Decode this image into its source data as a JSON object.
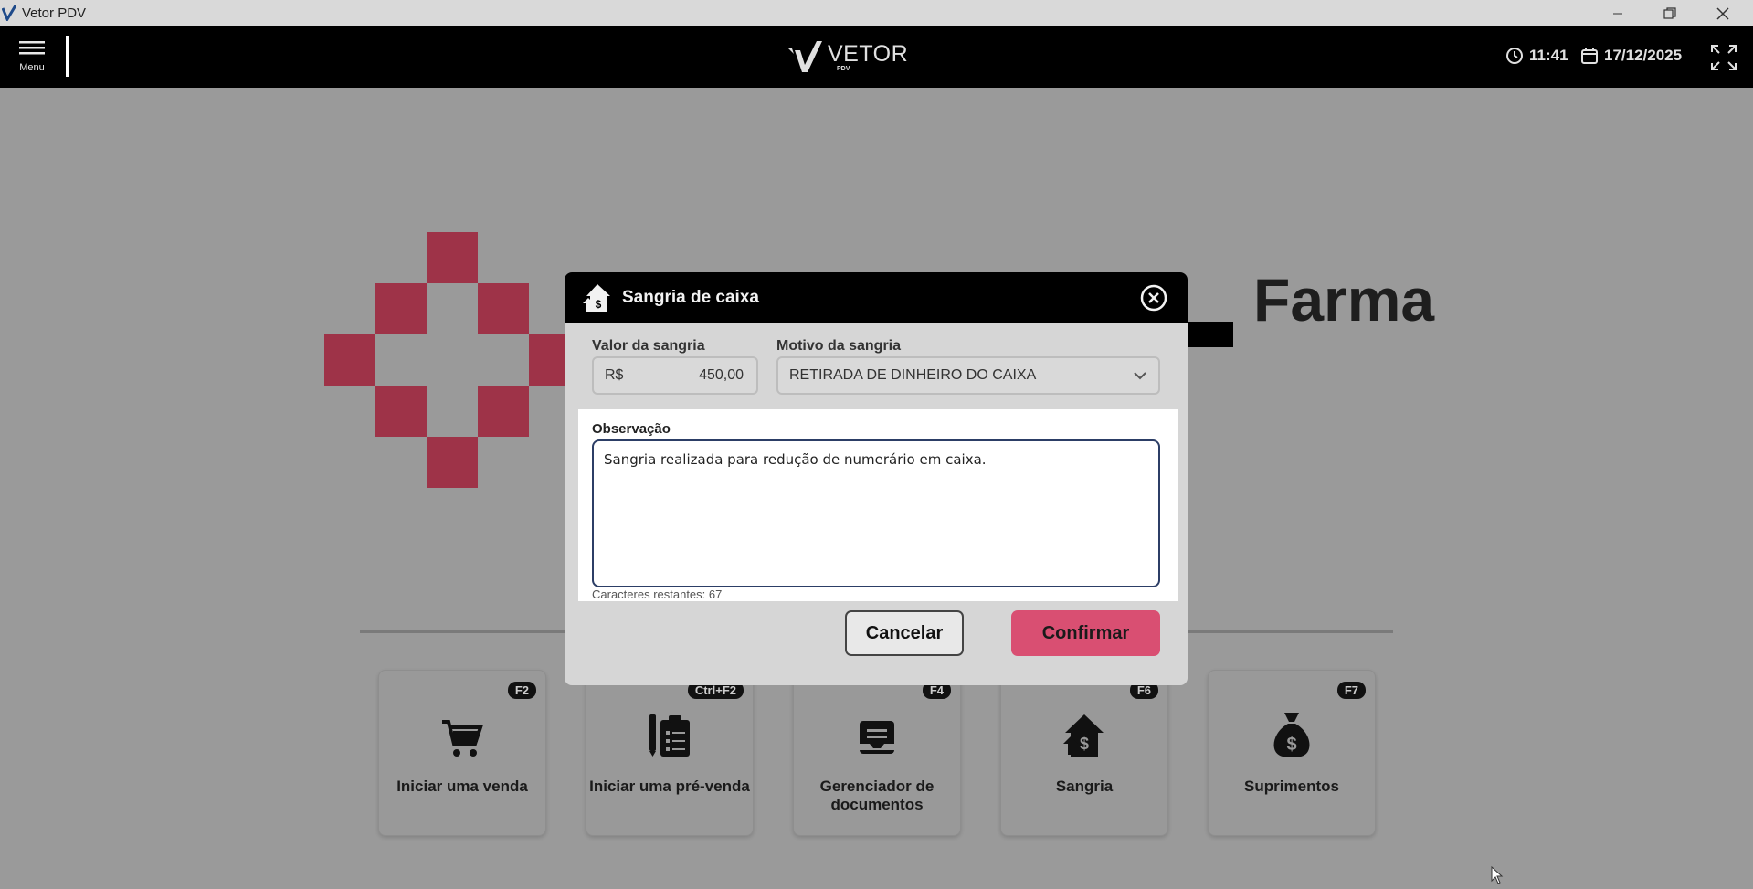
{
  "window": {
    "title": "Vetor PDV",
    "controls": [
      "minimize-icon",
      "restore-icon",
      "close-icon"
    ]
  },
  "header": {
    "menu_label": "Menu",
    "brand_word": "VETOR",
    "brand_sub": "PDV",
    "time": "11:41",
    "date": "17/12/2025"
  },
  "background": {
    "brand_text": "Farma",
    "cross_color": "#9e3348",
    "cards": [
      {
        "key": "F2",
        "label": "Iniciar uma venda",
        "icon": "cart-icon"
      },
      {
        "key": "Ctrl+F2",
        "label": "Iniciar uma pré-venda",
        "icon": "clipboard-pen-icon"
      },
      {
        "key": "F4",
        "label": "Gerenciador de documentos",
        "icon": "document-icon"
      },
      {
        "key": "F6",
        "label": "Sangria",
        "icon": "sangria-icon"
      },
      {
        "key": "F7",
        "label": "Suprimentos",
        "icon": "money-bag-icon"
      }
    ]
  },
  "modal": {
    "title": "Sangria de caixa",
    "valor_label": "Valor da sangria",
    "currency": "R$",
    "valor_value": "450,00",
    "motivo_label": "Motivo da sangria",
    "motivo_value": "RETIRADA DE DINHEIRO DO CAIXA",
    "observacao_label": "Observação",
    "observacao_value": "Sangria realizada para redução de numerário em caixa.",
    "remaining_text": "Caracteres restantes: 67",
    "cancel_label": "Cancelar",
    "confirm_label": "Confirmar",
    "confirm_color": "#d94f72"
  }
}
